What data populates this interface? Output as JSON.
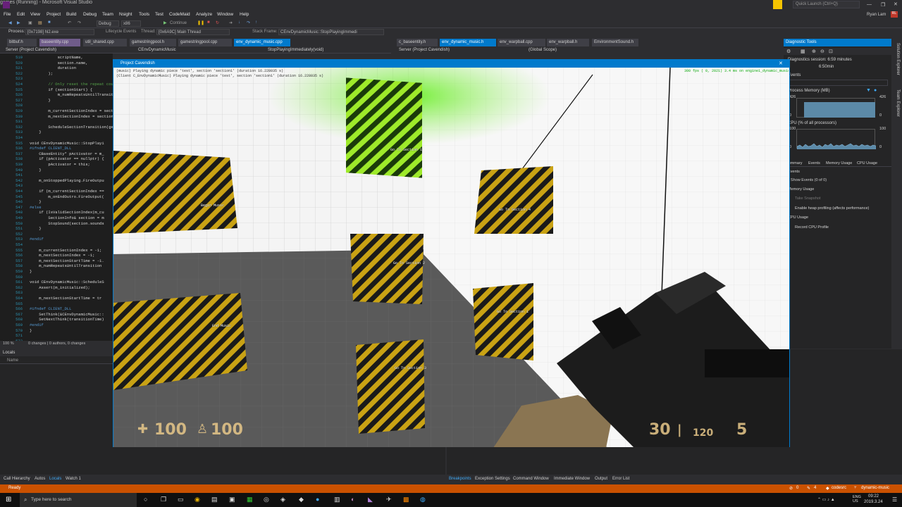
{
  "window": {
    "title": "games (Running) - Microsoft Visual Studio",
    "user": "Ryan Lam",
    "quick_launch": "Quick Launch (Ctrl+Q)"
  },
  "menu": [
    "File",
    "Edit",
    "View",
    "Project",
    "Build",
    "Debug",
    "Team",
    "Nsight",
    "Tools",
    "Test",
    "CodeMaid",
    "Analyze",
    "Window",
    "Help"
  ],
  "toolbar": {
    "config": "Debug",
    "platform": "x86",
    "continue": "Continue",
    "process_label": "Process:",
    "process": "[0x7198] hl2.exe",
    "lifecycle": "Lifecycle Events",
    "thread_label": "Thread:",
    "thread": "[0x6A9C] Main Thread",
    "stackframe_label": "Stack Frame:",
    "stackframe": "CEnvDynamicMusic::StopPlayingImmedi"
  },
  "tabs_left": [
    "bitbuf.h",
    "baseentity.cpp",
    "util_shared.cpp",
    "gamestringpool.h",
    "gamestringpool.cpp",
    "env_dynamic_music.cpp"
  ],
  "tabs_right": [
    "c_baseentity.h",
    "env_dynamic_music.h",
    "env_warpball.cpp",
    "env_warpball.h",
    "EnvironmentSound.h"
  ],
  "nav": {
    "project": "Server (Project Cavendish)",
    "class": "CEnvDynamicMusic",
    "member": "StopPlayingImmediately(void)",
    "project2": "Server (Project Cavendish)",
    "scope": "(Global Scope)"
  },
  "code": {
    "lines": [
      "519",
      "520",
      "521",
      "522",
      "523",
      "524",
      "525",
      "526",
      "527",
      "528",
      "529",
      "530",
      "531",
      "532",
      "533",
      "534",
      "535",
      "536",
      "537",
      "538",
      "539",
      "540",
      "541",
      "542",
      "543",
      "544",
      "545",
      "546",
      "547",
      "548",
      "549",
      "550",
      "551",
      "552",
      "553",
      "554",
      "555",
      "556",
      "557",
      "558",
      "559",
      "560",
      "561",
      "562",
      "563",
      "564",
      "565",
      "566",
      "567",
      "568",
      "569",
      "570",
      "571",
      "572"
    ],
    "text": [
      "            scriptName,",
      "            section.name,",
      "            duration",
      "        );",
      "",
      "        // Only reset the repeat cou",
      "        if (sectionStart) {",
      "            m_numRepeatsUntilTransiti",
      "        }",
      "",
      "        m_currentSectionIndex = sect",
      "        m_nextSectionIndex = section",
      "",
      "        ScheduleSectionTransition(ge",
      "    }",
      "",
      "void CEnvDynamicMusic::StopPlayi",
      "#ifndef CLIENT_DLL",
      "    CBaseEntity* pActivator = m_",
      "    if (pActivator == nullptr) {",
      "        pActivator = this;",
      "    }",
      "",
      "    m_onStoppedPlaying.FireOutpu",
      "",
      "    if (m_currentSectionIndex ==",
      "        m_onEndOutro.FireOutput(",
      "    }",
      "#else",
      "    if (IsValidSectionIndex(m_cu",
      "        SectionInfo& section = m",
      "        StopSound(section.sounds",
      "    }",
      "",
      "#endif",
      "",
      "    m_currentSectionIndex = -1;",
      "    m_nextSectionIndex = -1;",
      "    m_nextSectionStartTime = -1.",
      "    m_numRepeatsUntilTransition",
      "}",
      "",
      "void CEnvDynamicMusic::ScheduleS",
      "    Assert(m_initialized);",
      "",
      "    m_nextSectionStartTime = tr",
      "",
      "#ifndef CLIENT_DLL",
      "    SetThink(&CEnvDynamicMusic::",
      "    SetNextThink(transitionTime)",
      "#endif",
      "}",
      "",
      ""
    ]
  },
  "editor_status": {
    "zoom": "100 %",
    "changes": "0 changes | 0 authors, 0 changes"
  },
  "locals": {
    "title": "Locals",
    "col_name": "Name",
    "tabs": [
      "Call Hierarchy",
      "Autos",
      "Locals",
      "Watch 1"
    ]
  },
  "bottom_right_tabs": [
    "Breakpoints",
    "Exception Settings",
    "Command Window",
    "Immediate Window",
    "Output",
    "Error List"
  ],
  "diagnostics": {
    "title": "Diagnostic Tools",
    "session": "Diagnostics session: 6:59 minutes",
    "time_mark": "6:50min",
    "events": "Events",
    "process_memory": "Process Memory (MB)",
    "mem_top": "426",
    "mem_bottom": "0",
    "mem_left_top": "426",
    "cpu": "CPU (% of all processors)",
    "cpu_top": "100",
    "cpu_bottom": "0",
    "tabs": [
      "Summary",
      "Events",
      "Memory Usage",
      "CPU Usage"
    ],
    "sec_events": "Events",
    "show_events": "Show Events (0 of 0)",
    "sec_memory": "Memory Usage",
    "take_snapshot": "Take Snapshot",
    "heap": "Enable heap profiling (affects performance)",
    "sec_cpu": "CPU Usage",
    "record_cpu": "Record CPU Profile",
    "side": [
      "Solution Explorer",
      "Team Explorer"
    ]
  },
  "game": {
    "title": "Project Cavendish",
    "console1": "(music) Playing dynamic piece 'test', section 'section1' (duration 16.228035 s)",
    "console2": "(Client C_EnvDynamicMusic) Playing dynamic piece 'test', section 'section1' (duration 16.228035 s)",
    "fps": "300 fps (  0, 2021) 3.4 ms on engine1_dynamic_music",
    "crates": [
      "Begin Music",
      "Go To Section 1",
      "Go To Section 4",
      "Go To Section 2",
      "End Music",
      "Go To Section 1",
      "Go To Section 3"
    ],
    "hud_health": "100",
    "hud_armor": "100",
    "hud_ammo": "30",
    "hud_reserve": "120",
    "hud_grenades": "5"
  },
  "status": {
    "ready": "Ready",
    "errors": "0",
    "warnings": "4",
    "repo": "codesrc",
    "branch": "dynamic-music"
  },
  "taskbar": {
    "search": "Type here to search",
    "time": "09:22",
    "date": "2019.3.24",
    "lang": "ENG\nUS"
  }
}
